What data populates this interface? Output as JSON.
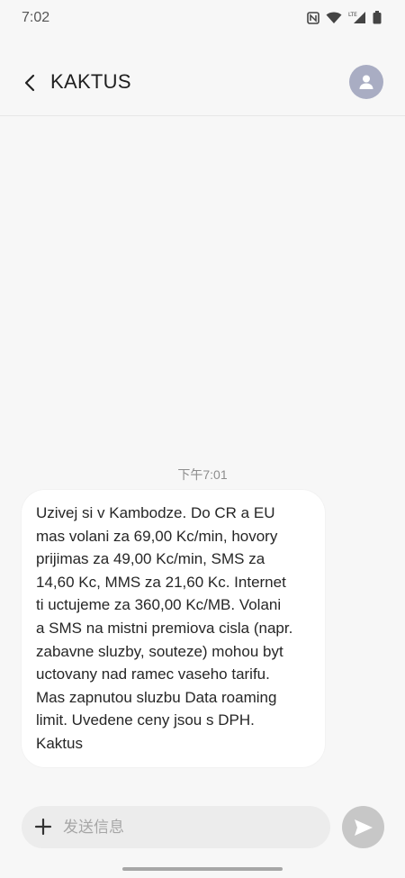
{
  "status_bar": {
    "time": "7:02",
    "icons": [
      "nfc-icon",
      "wifi-icon",
      "lte-signal-icon",
      "battery-icon"
    ],
    "lte_label": "LTE"
  },
  "header": {
    "back_icon": "chevron-left-icon",
    "title": "KAKTUS",
    "avatar_icon": "person-icon"
  },
  "conversation": {
    "timestamp": "下午7:01",
    "messages": [
      {
        "lines": [
          "Uzivej si v Kambodze. Do CR a EU",
          "mas volani za 69,00 Kc/min, hovory",
          "prijimas za 49,00 Kc/min, SMS za",
          "14,60 Kc, MMS za 21,60 Kc. Internet",
          "ti uctujeme za 360,00 Kc/MB. Volani",
          "a SMS na mistni premiova cisla (napr.",
          "zabavne sluzby, souteze) mohou byt",
          "uctovany nad ramec vaseho tarifu.",
          "Mas zapnutou sluzbu Data roaming",
          "limit. Uvedene ceny jsou s DPH.",
          "Kaktus"
        ]
      }
    ]
  },
  "composer": {
    "placeholder": "发送信息",
    "value": "",
    "add_icon": "plus-icon",
    "send_icon": "send-icon"
  },
  "colors": {
    "background": "#f7f7f7",
    "bubble": "#ffffff",
    "avatar": "#a9adc3",
    "send_button": "#c7c7c7"
  }
}
